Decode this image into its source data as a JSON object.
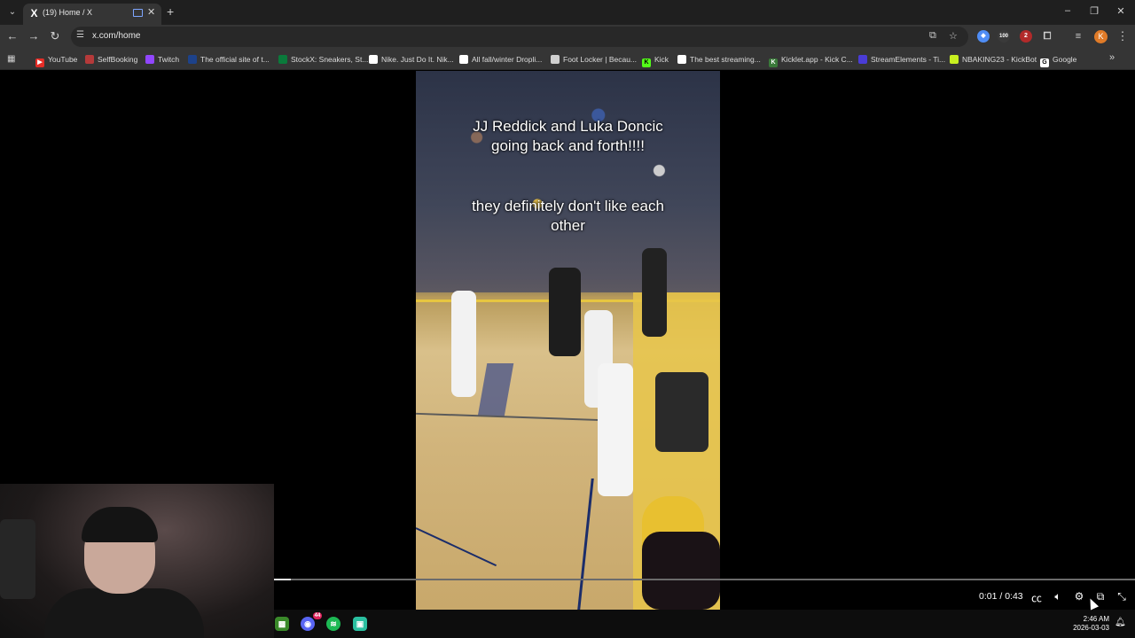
{
  "browser": {
    "tab": {
      "title": "(19) Home / X",
      "favicon": "X"
    },
    "url": "x.com/home",
    "extension_badge_100": "100",
    "extension_badge_2": "2",
    "profile_initial": "K",
    "bookmarks": [
      {
        "label": "YouTube",
        "color": "#e52d27",
        "icon": "▶"
      },
      {
        "label": "SelfBooking",
        "color": "#b53a3a",
        "icon": ""
      },
      {
        "label": "Twitch",
        "color": "#9146ff",
        "icon": ""
      },
      {
        "label": "The official site of t...",
        "color": "#1d428a",
        "icon": ""
      },
      {
        "label": "StockX: Sneakers, St...",
        "color": "#0a7a3b",
        "icon": ""
      },
      {
        "label": "Nike. Just Do It. Nik...",
        "color": "#ffffff",
        "icon": ""
      },
      {
        "label": "All fall/winter Dropli...",
        "color": "#ffffff",
        "icon": ""
      },
      {
        "label": "Foot Locker | Becau...",
        "color": "#cfcfcf",
        "icon": ""
      },
      {
        "label": "Kick",
        "color": "#53fc18",
        "icon": "K"
      },
      {
        "label": "The best streaming...",
        "color": "#ffffff",
        "icon": ""
      },
      {
        "label": "Kicklet.app - Kick C...",
        "color": "#3a7a3a",
        "icon": "K"
      },
      {
        "label": "StreamElements - Ti...",
        "color": "#4a3cd6",
        "icon": ""
      },
      {
        "label": "NBAKING23 - KickBot",
        "color": "#c8f020",
        "icon": ""
      },
      {
        "label": "Google",
        "color": "#ffffff",
        "icon": "G"
      }
    ]
  },
  "video": {
    "caption_line1": "JJ Reddick and Luka Doncic going back and forth!!!!",
    "caption_line2": "they definitely don't like each other",
    "current_time": "0:01",
    "duration": "0:43",
    "time_display": "0:01 / 0:43",
    "progress_fraction": 0.02
  },
  "taskbar": {
    "discord_badge": "44",
    "time": "2:46 AM",
    "date": "2026-03-03"
  }
}
